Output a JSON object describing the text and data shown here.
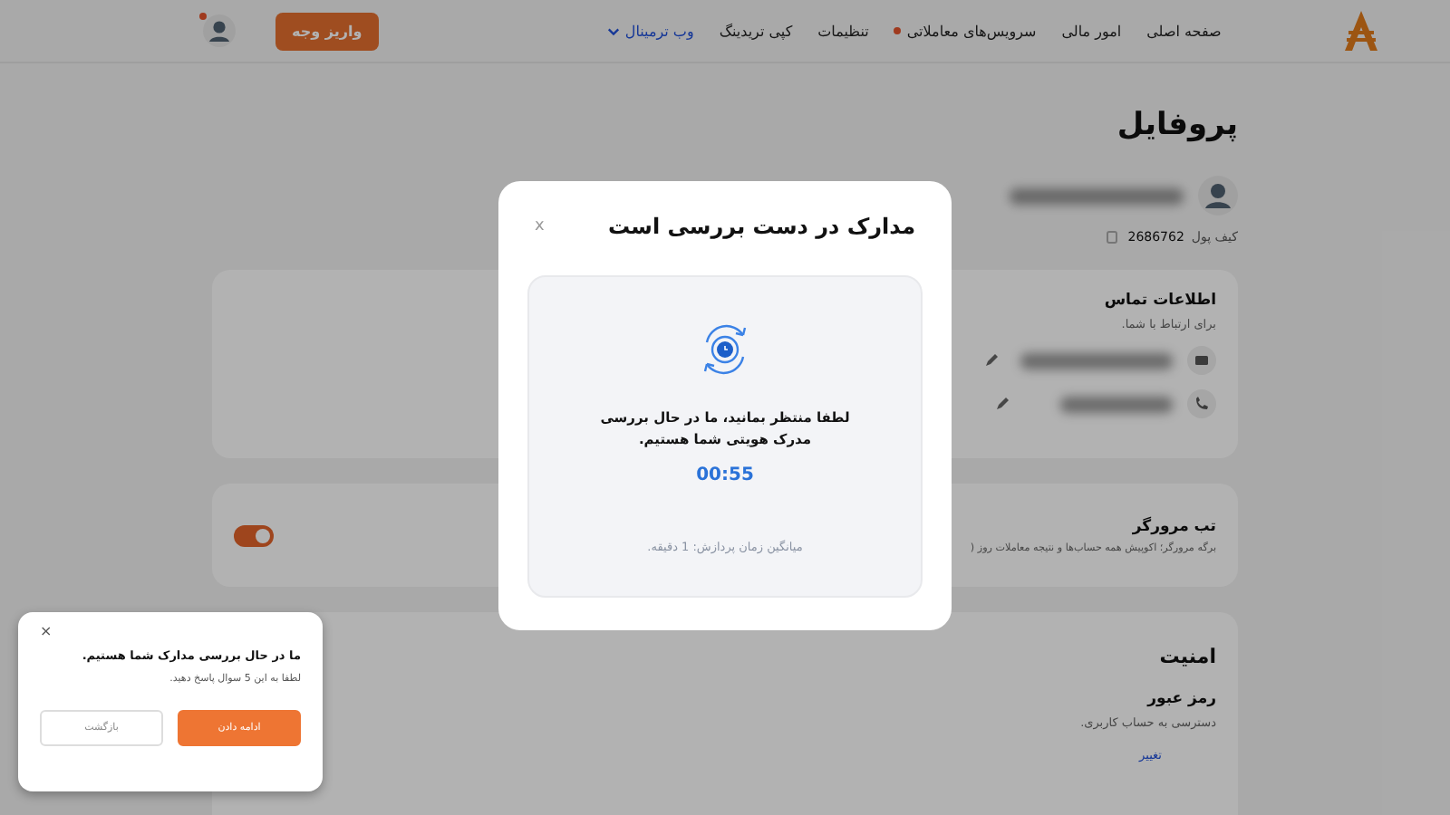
{
  "header": {
    "nav": [
      {
        "label": "صفحه اصلی",
        "kind": "link",
        "dot": false
      },
      {
        "label": "امور مالی",
        "kind": "link",
        "dot": false
      },
      {
        "label": "سرویس‌های معاملاتی",
        "kind": "link",
        "dot": true
      },
      {
        "label": "تنظیمات",
        "kind": "link",
        "dot": false
      },
      {
        "label": "کپی تریدینگ",
        "kind": "link",
        "dot": false
      },
      {
        "label": "وب ترمینال",
        "kind": "dropdown",
        "dot": false
      }
    ],
    "deposit_button": "واریز وجه",
    "avatar_dot": true
  },
  "page": {
    "title": "پروفایل",
    "wallet_label": "کیف پول",
    "wallet_id": "2686762",
    "contact": {
      "title": "اطلاعات تماس",
      "subtitle": "برای ارتباط با شما.",
      "rows": [
        {
          "kind": "email"
        },
        {
          "kind": "phone"
        }
      ]
    },
    "browser_tab": {
      "title": "تب مرورگر",
      "description": "برگه مرورگر؛ اکوپیش همه حساب‌ها و نتیجه معاملات روز (",
      "on": true
    },
    "security": {
      "title": "امنیت",
      "item_title": "رمز عبور",
      "item_subtitle": "دسترسی به حساب کاربری.",
      "link": "تغییر"
    }
  },
  "modal": {
    "title": "مدارک در دست بررسی است",
    "close": "x",
    "message": "لطفا منتظر بمانید، ما در حال بررسی مدرک هویتی شما هستیم.",
    "timer": "00:55",
    "note": "میانگین زمان پردازش: 1 دقیقه."
  },
  "toast": {
    "close": "×",
    "title": "ما در حال بررسی مدارک شما هستیم.",
    "text": "لطفا به این 5 سوال پاسخ دهید.",
    "buttons": [
      {
        "label": "ادامه دادن",
        "kind": "primary"
      },
      {
        "label": "بازگشت",
        "kind": "secondary"
      }
    ]
  }
}
